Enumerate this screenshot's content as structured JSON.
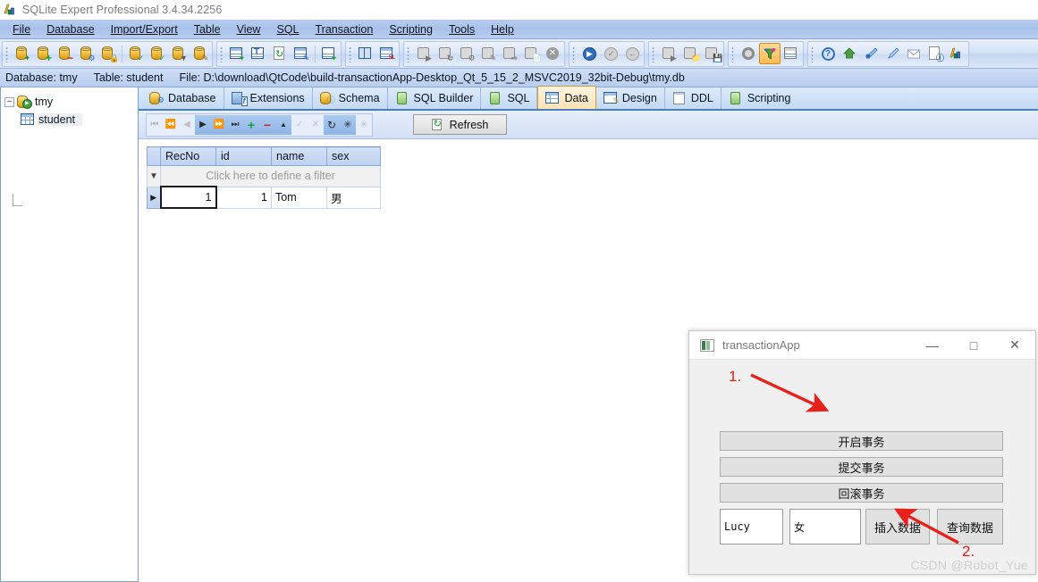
{
  "window": {
    "title": "SQLite Expert Professional 3.4.34.2256",
    "icon": "sqlite-expert-logo-icon"
  },
  "menubar": {
    "items": [
      {
        "label": "File",
        "accel": "F"
      },
      {
        "label": "Database",
        "accel": "D"
      },
      {
        "label": "Import/Export",
        "accel": "I"
      },
      {
        "label": "Table",
        "accel": "T"
      },
      {
        "label": "View",
        "accel": "V"
      },
      {
        "label": "SQL",
        "accel": "S"
      },
      {
        "label": "Transaction",
        "accel": "r"
      },
      {
        "label": "Scripting",
        "accel": "c"
      },
      {
        "label": "Tools",
        "accel": "o"
      },
      {
        "label": "Help",
        "accel": "H"
      }
    ]
  },
  "toolbar": {
    "groups": [
      {
        "name": "database-group",
        "buttons": [
          {
            "name": "new-database-button",
            "icon": "database-new-icon"
          },
          {
            "name": "add-database-button",
            "icon": "database-add-icon"
          },
          {
            "name": "remove-database-button",
            "icon": "database-remove-icon"
          },
          {
            "name": "database-properties-button",
            "icon": "database-settings-icon"
          },
          {
            "name": "encrypt-database-button",
            "icon": "database-lock-icon"
          },
          {
            "name": "separator",
            "icon": "separator"
          },
          {
            "name": "attach-database-button",
            "icon": "database-attach-icon"
          },
          {
            "name": "verify-database-button",
            "icon": "database-check-icon"
          },
          {
            "name": "compact-database-button",
            "icon": "database-compact-icon"
          },
          {
            "name": "analyze-database-button",
            "icon": "database-tool-icon"
          }
        ]
      },
      {
        "name": "table-group",
        "buttons": [
          {
            "name": "new-table-button",
            "icon": "table-new-icon"
          },
          {
            "name": "rename-table-button",
            "icon": "table-rename-icon"
          },
          {
            "name": "refresh-table-button",
            "icon": "table-refresh-icon"
          },
          {
            "name": "table-design-button",
            "icon": "table-design-icon"
          },
          {
            "name": "separator",
            "icon": "separator"
          },
          {
            "name": "table-relations-button",
            "icon": "table-relations-icon"
          }
        ]
      },
      {
        "name": "view-group",
        "buttons": [
          {
            "name": "split-view-button",
            "icon": "split-view-icon"
          },
          {
            "name": "sql-view-button",
            "icon": "sql-view-icon"
          }
        ]
      },
      {
        "name": "sql-group",
        "buttons": [
          {
            "name": "run-sql-button",
            "icon": "sql-run-icon"
          },
          {
            "name": "sql-history-button",
            "icon": "sql-history-icon"
          },
          {
            "name": "sql-params-button",
            "icon": "sql-params-icon"
          },
          {
            "name": "sql-plan-button",
            "icon": "sql-plan-icon"
          },
          {
            "name": "sql-export-button",
            "icon": "sql-export-icon"
          },
          {
            "name": "sql-save-button",
            "icon": "sql-save-icon"
          },
          {
            "name": "sql-stop-button",
            "icon": "sql-stop-icon"
          }
        ]
      },
      {
        "name": "transaction-group",
        "buttons": [
          {
            "name": "begin-transaction-button",
            "icon": "transaction-begin-icon"
          },
          {
            "name": "commit-transaction-button",
            "icon": "transaction-commit-icon"
          },
          {
            "name": "rollback-transaction-button",
            "icon": "transaction-rollback-icon"
          }
        ]
      },
      {
        "name": "script-group",
        "buttons": [
          {
            "name": "run-script-button",
            "icon": "script-run-icon"
          },
          {
            "name": "open-script-button",
            "icon": "script-open-icon"
          },
          {
            "name": "save-script-button",
            "icon": "script-save-icon"
          }
        ]
      },
      {
        "name": "tools-group",
        "buttons": [
          {
            "name": "options-button",
            "icon": "gear-icon"
          },
          {
            "name": "filter-button",
            "icon": "funnel-icon",
            "selected": true
          },
          {
            "name": "grid-options-button",
            "icon": "grid-icon"
          }
        ]
      },
      {
        "name": "help-group",
        "buttons": [
          {
            "name": "help-button",
            "icon": "question-circle-icon"
          },
          {
            "name": "home-page-button",
            "icon": "home-icon"
          },
          {
            "name": "support-button",
            "icon": "support-icon"
          },
          {
            "name": "register-button",
            "icon": "key-icon"
          },
          {
            "name": "feedback-button",
            "icon": "mail-icon"
          },
          {
            "name": "about-doc-button",
            "icon": "document-info-icon"
          },
          {
            "name": "about-button",
            "icon": "about-logo-icon"
          }
        ]
      }
    ]
  },
  "pathbar": {
    "database_label": "Database: tmy",
    "table_label": "Table: student",
    "file_label": "File: D:\\download\\QtCode\\build-transactionApp-Desktop_Qt_5_15_2_MSVC2019_32bit-Debug\\tmy.db"
  },
  "tree": {
    "root": {
      "label": "tmy",
      "icon": "database-connected-icon",
      "expanded": true,
      "expander": "−"
    },
    "children": [
      {
        "label": "student",
        "icon": "table-icon",
        "selected": true
      }
    ]
  },
  "tabs": [
    {
      "label": "Database",
      "icon": "database-settings-icon",
      "active": false
    },
    {
      "label": "Extensions",
      "icon": "function-icon",
      "active": false
    },
    {
      "label": "Schema",
      "icon": "schema-icon",
      "active": false
    },
    {
      "label": "SQL Builder",
      "icon": "sql-builder-icon",
      "active": false
    },
    {
      "label": "SQL",
      "icon": "sql-icon",
      "active": false
    },
    {
      "label": "Data",
      "icon": "data-grid-icon",
      "active": true
    },
    {
      "label": "Design",
      "icon": "design-icon",
      "active": false
    },
    {
      "label": "DDL",
      "icon": "ddl-notepad-icon",
      "active": false
    },
    {
      "label": "Scripting",
      "icon": "scripting-icon",
      "active": false
    }
  ],
  "navbar": {
    "buttons": [
      {
        "name": "first-record-button",
        "glyph": "⏮",
        "enabled": false
      },
      {
        "name": "prior-page-button",
        "glyph": "⏪",
        "enabled": false
      },
      {
        "name": "prior-record-button",
        "glyph": "◀",
        "enabled": false
      },
      {
        "name": "next-record-button",
        "glyph": "▶",
        "enabled": true
      },
      {
        "name": "next-page-button",
        "glyph": "⏩",
        "enabled": true
      },
      {
        "name": "last-record-button",
        "glyph": "⏭",
        "enabled": true
      },
      {
        "name": "insert-record-button",
        "glyph": "+",
        "enabled": true
      },
      {
        "name": "delete-record-button",
        "glyph": "−",
        "enabled": true
      },
      {
        "name": "edit-record-button",
        "glyph": "▲",
        "enabled": true
      },
      {
        "name": "post-edit-button",
        "glyph": "✓",
        "enabled": false
      },
      {
        "name": "cancel-edit-button",
        "glyph": "✕",
        "enabled": false
      },
      {
        "name": "refresh-record-button",
        "glyph": "↻",
        "enabled": true
      },
      {
        "name": "clear-filter-button",
        "glyph": "✳",
        "enabled": true
      },
      {
        "name": "apply-filter-button",
        "glyph": "✳",
        "enabled": false
      }
    ],
    "refresh_label": "Refresh",
    "refresh_icon": "refresh-icon"
  },
  "grid": {
    "filter_placeholder": "Click here to define a filter",
    "filter_icon": "funnel-icon",
    "columns": [
      "RecNo",
      "id",
      "name",
      "sex"
    ],
    "rows": [
      {
        "indicator": "▶",
        "RecNo": "1",
        "id": "1",
        "name": "Tom",
        "sex": "男"
      }
    ]
  },
  "dialog": {
    "title": "transactionApp",
    "icon": "app-window-icon",
    "window_buttons": [
      {
        "name": "minimize-button",
        "glyph": "—"
      },
      {
        "name": "maximize-button",
        "glyph": "□"
      },
      {
        "name": "close-button",
        "glyph": "✕"
      }
    ],
    "buttons": {
      "begin": "开启事务",
      "commit": "提交事务",
      "rollback": "回滚事务",
      "insert": "插入数据",
      "query": "查询数据"
    },
    "inputs": {
      "name_value": "Lucy",
      "sex_value": "女"
    },
    "annotations": [
      {
        "label": "1.",
        "target": "begin-transaction-button"
      },
      {
        "label": "2.",
        "target": "insert-data-button"
      }
    ],
    "watermark": "CSDN @Robot_Yue",
    "accent_color": "#e8211b"
  }
}
